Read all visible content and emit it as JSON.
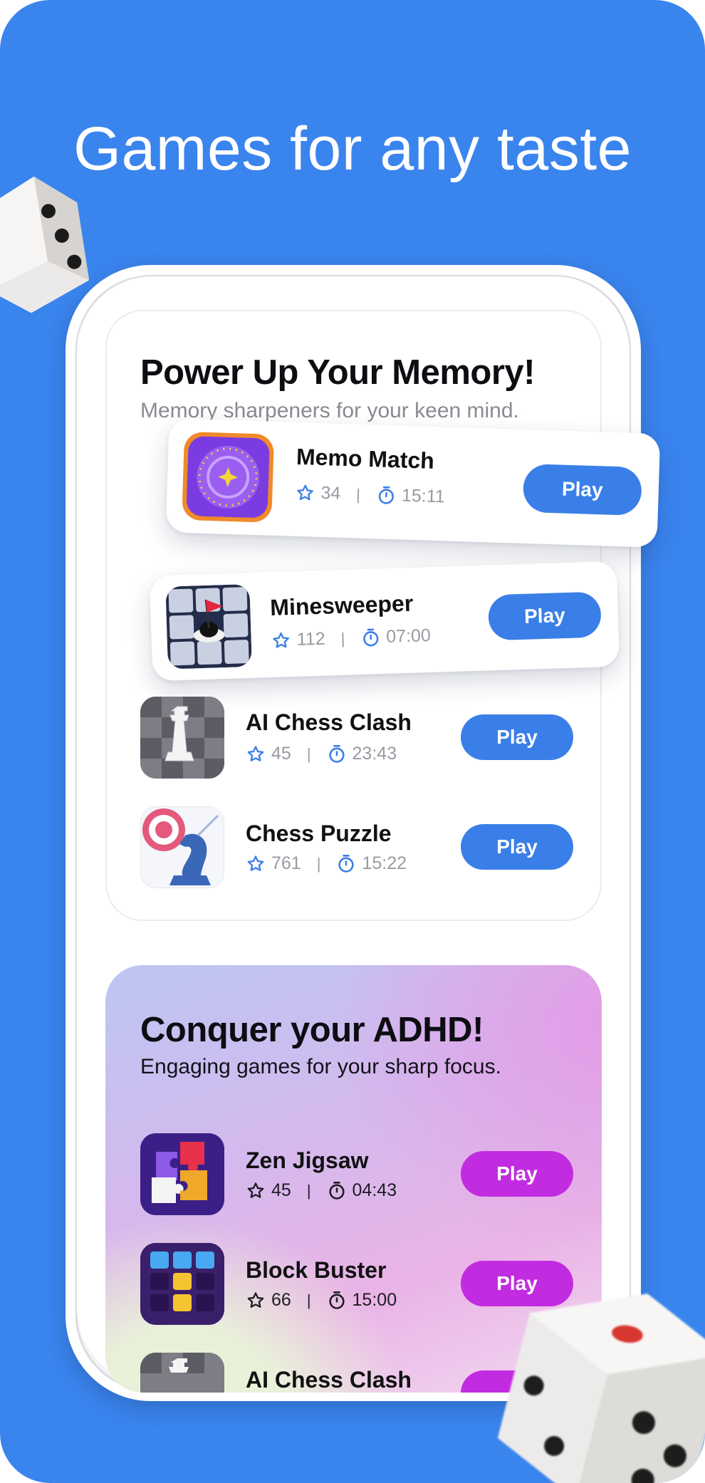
{
  "headline": "Games for any taste",
  "memory_section": {
    "title": "Power Up Your Memory!",
    "subtitle": "Memory sharpeners for your keen mind.",
    "games": [
      {
        "name": "Memo Match",
        "rating": "34",
        "time": "15:11",
        "play_label": "Play"
      },
      {
        "name": "Minesweeper",
        "rating": "112",
        "time": "07:00",
        "play_label": "Play"
      },
      {
        "name": "AI Chess Clash",
        "rating": "45",
        "time": "23:43",
        "play_label": "Play"
      },
      {
        "name": "Chess Puzzle",
        "rating": "761",
        "time": "15:22",
        "play_label": "Play"
      }
    ]
  },
  "adhd_section": {
    "title": "Conquer your ADHD!",
    "subtitle": "Engaging games for your sharp focus.",
    "games": [
      {
        "name": "Zen Jigsaw",
        "rating": "45",
        "time": "04:43",
        "play_label": "Play"
      },
      {
        "name": "Block Buster",
        "rating": "66",
        "time": "15:00",
        "play_label": "Play"
      },
      {
        "name": "AI Chess Clash",
        "rating": "",
        "time": "",
        "play_label": ""
      }
    ]
  },
  "colors": {
    "background": "#3a84ee",
    "play_blue": "#3a7fe8",
    "play_purple": "#c22ce0"
  }
}
